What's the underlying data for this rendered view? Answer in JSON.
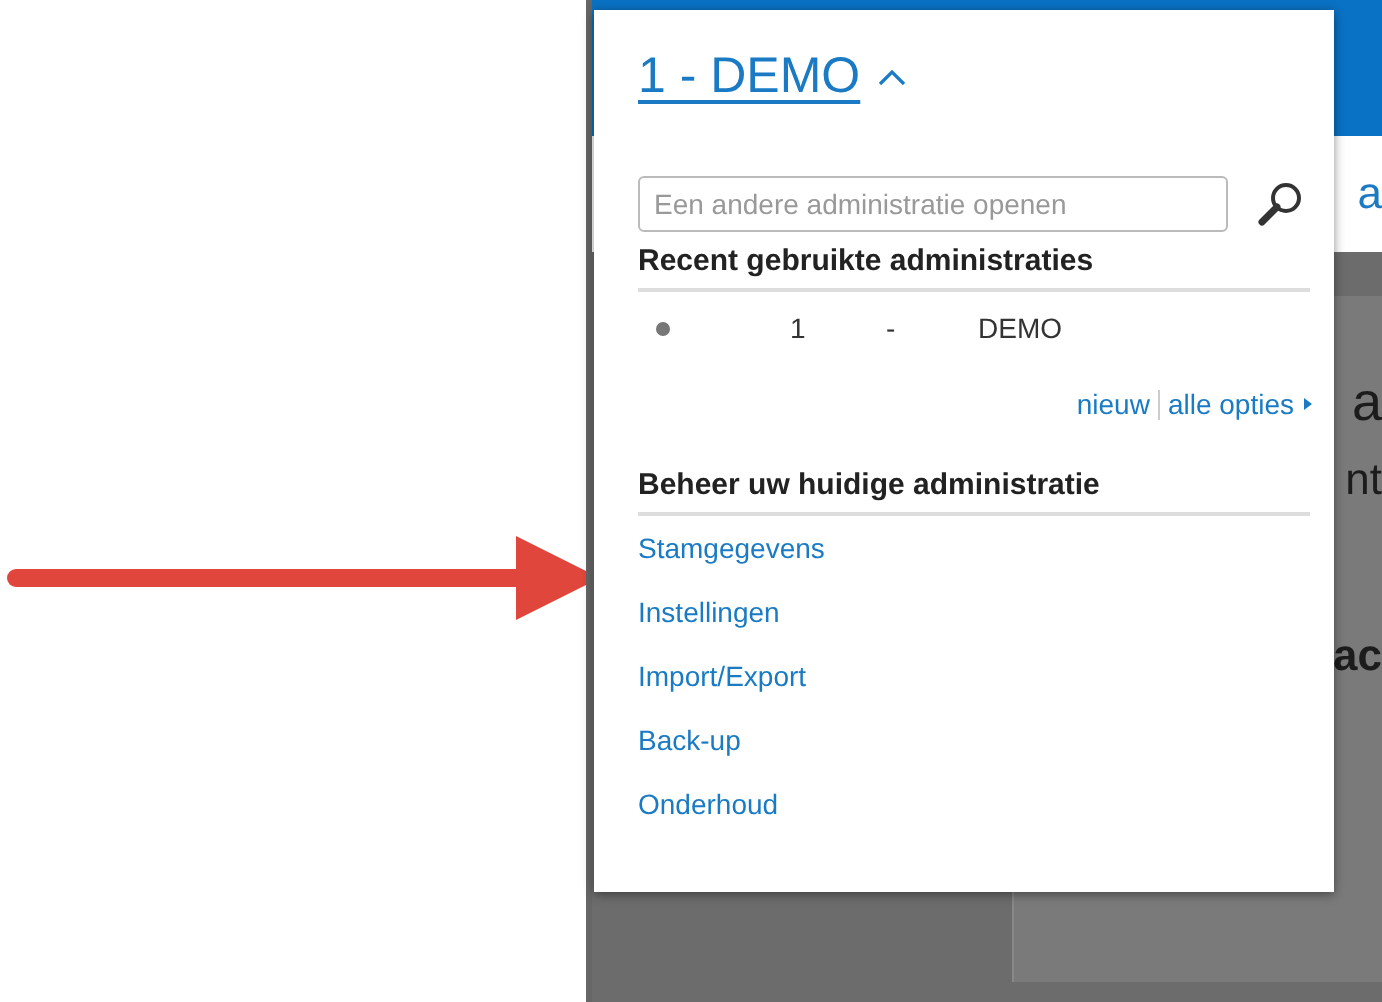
{
  "title": "1 - DEMO",
  "menu_expanded": true,
  "search": {
    "placeholder": "Een andere administratie openen"
  },
  "recent": {
    "heading": "Recent gebruikte administraties",
    "items": [
      {
        "number": "1",
        "separator": "-",
        "name": "DEMO"
      }
    ],
    "links": [
      "nieuw",
      "alle opties"
    ]
  },
  "manage": {
    "heading": "Beheer uw huidige administratie",
    "items": [
      {
        "label": "Stamgegevens"
      },
      {
        "label": "Instellingen"
      },
      {
        "label": "Import/Export"
      },
      {
        "label": "Back-up"
      },
      {
        "label": "Onderhoud"
      }
    ]
  },
  "background_fragments": [
    "a",
    "a",
    "nt",
    "ac"
  ]
}
